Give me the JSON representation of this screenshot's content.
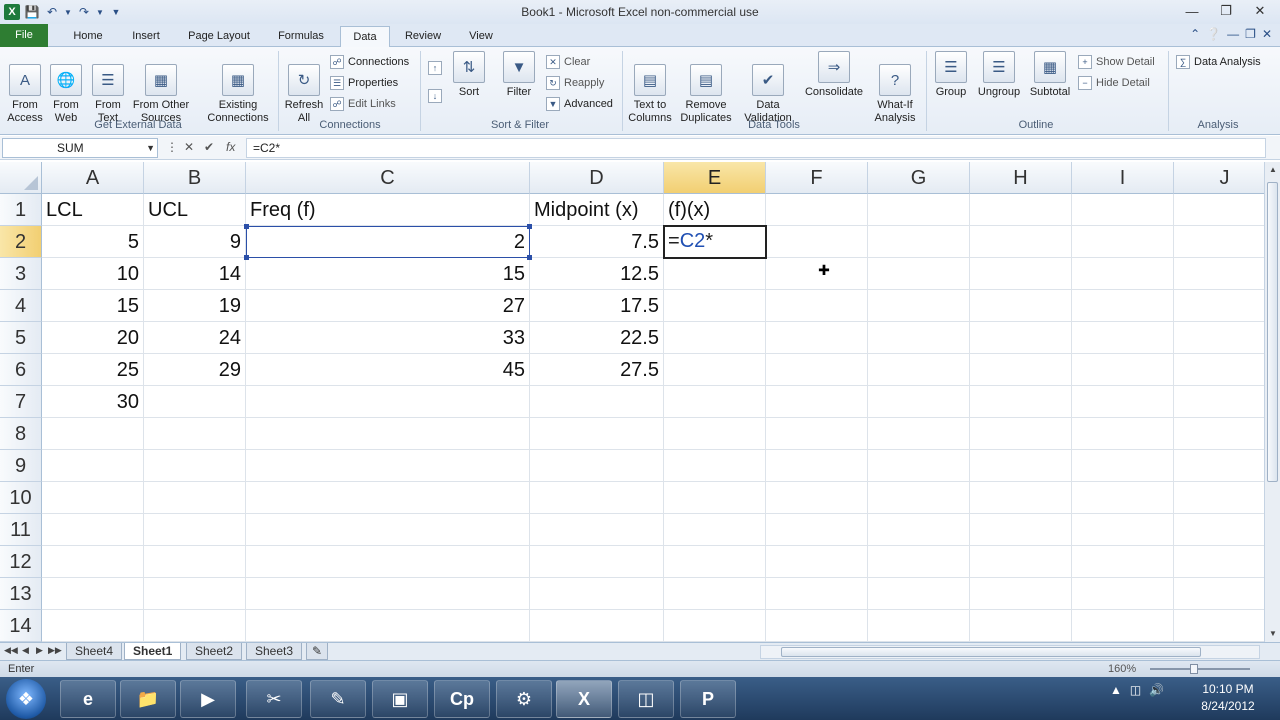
{
  "window": {
    "title": "Book1 - Microsoft Excel non-commercial use"
  },
  "ribbon_tabs": [
    {
      "label": "File"
    },
    {
      "label": "Home"
    },
    {
      "label": "Insert"
    },
    {
      "label": "Page Layout"
    },
    {
      "label": "Formulas"
    },
    {
      "label": "Data"
    },
    {
      "label": "Review"
    },
    {
      "label": "View"
    }
  ],
  "active_tab": "Data",
  "ribbon": {
    "get_external": {
      "group_label": "Get External Data",
      "from_access": "From\nAccess",
      "from_web": "From\nWeb",
      "from_text": "From\nText",
      "from_other": "From Other\nSources",
      "existing": "Existing\nConnections"
    },
    "connections": {
      "group_label": "Connections",
      "refresh_all": "Refresh\nAll",
      "connections": "Connections",
      "properties": "Properties",
      "edit_links": "Edit Links"
    },
    "sort_filter": {
      "group_label": "Sort & Filter",
      "sort": "Sort",
      "filter": "Filter",
      "clear": "Clear",
      "reapply": "Reapply",
      "advanced": "Advanced"
    },
    "data_tools": {
      "group_label": "Data Tools",
      "text_to_columns": "Text to\nColumns",
      "remove_duplicates": "Remove\nDuplicates",
      "data_validation": "Data\nValidation",
      "consolidate": "Consolidate",
      "what_if": "What-If\nAnalysis"
    },
    "outline": {
      "group_label": "Outline",
      "group": "Group",
      "ungroup": "Ungroup",
      "subtotal": "Subtotal",
      "show_detail": "Show Detail",
      "hide_detail": "Hide Detail"
    },
    "analysis": {
      "group_label": "Analysis",
      "data_analysis": "Data Analysis"
    }
  },
  "formula_bar": {
    "name_box": "SUM",
    "formula": "=C2*",
    "fx": "fx"
  },
  "columns": [
    "A",
    "B",
    "C",
    "D",
    "E",
    "F",
    "G",
    "H",
    "I",
    "J"
  ],
  "rows": [
    "1",
    "2",
    "3",
    "4",
    "5",
    "6",
    "7",
    "8",
    "9",
    "10",
    "11",
    "12",
    "13",
    "14"
  ],
  "cells": {
    "A1": "LCL",
    "B1": "UCL",
    "C1": "Freq (f)",
    "D1": "Midpoint (x)",
    "E1": "(f)(x)",
    "A2": "5",
    "B2": "9",
    "C2": "2",
    "D2": "7.5",
    "A3": "10",
    "B3": "14",
    "C3": "15",
    "D3": "12.5",
    "A4": "15",
    "B4": "19",
    "C4": "27",
    "D4": "17.5",
    "A5": "20",
    "B5": "24",
    "C5": "33",
    "D5": "22.5",
    "A6": "25",
    "B6": "29",
    "C6": "45",
    "D6": "27.5",
    "A7": "30"
  },
  "active_cell": {
    "ref": "E2",
    "prefix": "=",
    "reference_text": "C2",
    "suffix": "*"
  },
  "sheet_tabs": [
    {
      "label": "Sheet4"
    },
    {
      "label": "Sheet1"
    },
    {
      "label": "Sheet2"
    },
    {
      "label": "Sheet3"
    }
  ],
  "active_sheet": "Sheet1",
  "status_bar": {
    "mode": "Enter",
    "zoom": "160%"
  },
  "taskbar": {
    "time": "10:10 PM",
    "date": "8/24/2012"
  }
}
